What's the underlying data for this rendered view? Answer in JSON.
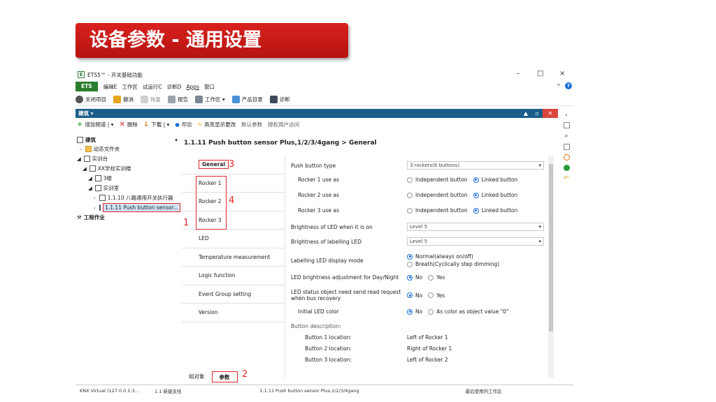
{
  "slide": {
    "title": "设备参数 - 通用设置"
  },
  "window": {
    "title": "ETS5™ - 开关基础功能",
    "app_icon": "ets-app-icon",
    "controls": {
      "minimize": "–",
      "maximize": "□",
      "close": "×"
    }
  },
  "menubar": {
    "ets_tab": "ETS",
    "items": [
      "编辑E",
      "工作区",
      "试运行C",
      "诊断D",
      "Apps",
      "窗口"
    ],
    "right_caret": "^",
    "help": "?"
  },
  "toolbar": {
    "items": [
      {
        "label": "关闭项目",
        "icon": "close-project-icon"
      },
      {
        "label": "撤消",
        "icon": "undo-icon"
      },
      {
        "label": "恢复",
        "icon": "redo-icon"
      },
      {
        "label": "报告",
        "icon": "print-icon"
      },
      {
        "label": "工作区 ▾",
        "icon": "workspace-icon"
      },
      {
        "label": "产品目录",
        "icon": "catalog-icon"
      },
      {
        "label": "诊断",
        "icon": "diagnostics-icon"
      }
    ]
  },
  "panel": {
    "title": "建筑 ▾"
  },
  "subtoolbar": {
    "items": [
      {
        "label": "增加频道 | ▾",
        "icon": "add-icon"
      },
      {
        "label": "删除",
        "icon": "delete-icon"
      },
      {
        "label": "下载 | ▾",
        "icon": "download-icon"
      },
      {
        "label": "帮助",
        "icon": "help-icon"
      },
      {
        "label": "高亮显示更改",
        "icon": "highlight-icon"
      },
      {
        "label": "默认参数",
        "icon": ""
      },
      {
        "label": "授权用户访问",
        "icon": ""
      }
    ]
  },
  "tree": {
    "header": "建筑",
    "rows": [
      {
        "label": "动态文件夹",
        "indent": 1
      },
      {
        "label": "实训台",
        "indent": 0
      },
      {
        "label": "XX学校实训楼",
        "indent": 1
      },
      {
        "label": "3楼",
        "indent": 2
      },
      {
        "label": "实训室",
        "indent": 2
      },
      {
        "label": "1.1.10 八路通用开关执行器",
        "indent": 3
      },
      {
        "label": "1.1.11 Push button sensor...",
        "indent": 3
      }
    ],
    "footer": "工程作业"
  },
  "annotations": {
    "a1": "1",
    "a2": "2",
    "a3": "3",
    "a4": "4"
  },
  "device": {
    "title": "1.1.11 Push button sensor Plus,1/2/3/4gang > General"
  },
  "nav": {
    "items": [
      "General",
      "Rocker 1",
      "Rocker 2",
      "Rocker 3",
      "LED",
      "Temperature measurement",
      "Logic function",
      "Event Group setting",
      "Version"
    ]
  },
  "params": {
    "push_button_type": {
      "label": "Push button type",
      "value": "3 rockers(6 buttons)"
    },
    "rocker1": {
      "label": "Rocker 1 use as"
    },
    "rocker2": {
      "label": "Rocker 2 use as"
    },
    "rocker3": {
      "label": "Rocker 3 use as"
    },
    "rocker_options": {
      "independent": "Independent button",
      "linked": "Linked button"
    },
    "brightness_led_on": {
      "label": "Brightness of LED when it is on",
      "value": "Level 5"
    },
    "brightness_labelling": {
      "label": "Brightness of labelling LED",
      "value": "Level 5"
    },
    "labelling_mode": {
      "label": "Labelling LED display mode",
      "opt1": "Normal(always on/off)",
      "opt2": "Breath(Cyclically step dimming)"
    },
    "day_night": {
      "label": "LED brightness adjustment for Day/Night",
      "no": "No",
      "yes": "Yes"
    },
    "status_object": {
      "label1": "LED status object need send read request",
      "label2": "when bus recovery",
      "no": "No",
      "yes": "Yes"
    },
    "initial_led": {
      "label": "Initial LED color",
      "no": "No",
      "alt": "As color as object value \"0\""
    },
    "button_description": {
      "label": "Button description:"
    },
    "buttons": [
      {
        "label": "Button 1 location:",
        "value": "Left of Rocker 1"
      },
      {
        "label": "Button 2 location:",
        "value": "Right of Rocker 1"
      },
      {
        "label": "Button 3 location:",
        "value": "Left of Rocker 2"
      }
    ]
  },
  "bottom_tabs": {
    "group_objects": "组对象",
    "parameters": "参数"
  },
  "statusbar": {
    "connection": "KNX Virtual (127.0.0.1:3...",
    "line": "1.1 新建支线",
    "device": "1.1.11 Push button sensor Plus,1/2/3/4gang",
    "workspace": "最后使用的工作区"
  },
  "colors": {
    "banner": "#c8191a",
    "ets_green": "#2a7d2e",
    "panel_blue": "#1b5e8a",
    "annotation_red": "#e0262a",
    "radio_blue": "#1e6fd9"
  }
}
